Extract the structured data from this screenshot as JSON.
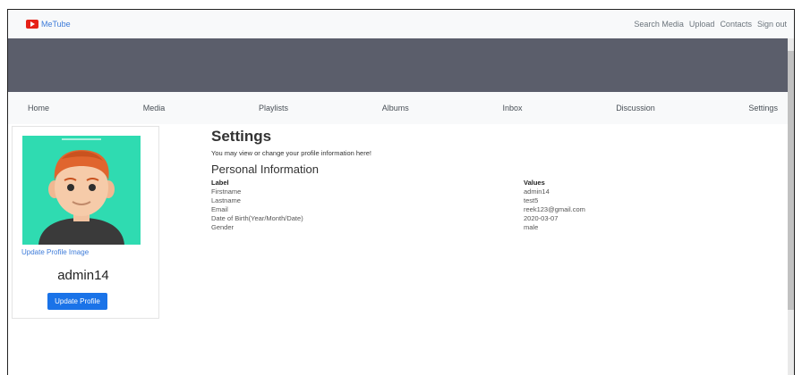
{
  "topbar": {
    "brand": "MeTube",
    "links": [
      "Search Media",
      "Upload",
      "Contacts",
      "Sign out"
    ]
  },
  "nav": {
    "items": [
      "Home",
      "Media",
      "Playlists",
      "Albums",
      "Inbox",
      "Discussion",
      "Settings"
    ]
  },
  "profile": {
    "update_image_label": "Update Profile Image",
    "username": "admin14",
    "update_button": "Update Profile"
  },
  "settings": {
    "title": "Settings",
    "subtitle": "You may view or change your profile information here!",
    "section_title": "Personal Information",
    "headers": [
      "Label",
      "Values"
    ],
    "rows": [
      [
        "Firstname",
        "admin14"
      ],
      [
        "Lastname",
        "test5"
      ],
      [
        "Email",
        "reek123@gmail.com"
      ],
      [
        "Date of Birth(Year/Month/Date)",
        "2020-03-07"
      ],
      [
        "Gender",
        "male"
      ]
    ]
  },
  "colors": {
    "banner": "#5b5e6b",
    "accent": "#1a73e8",
    "avatar_bg": "#2fdbb1"
  }
}
